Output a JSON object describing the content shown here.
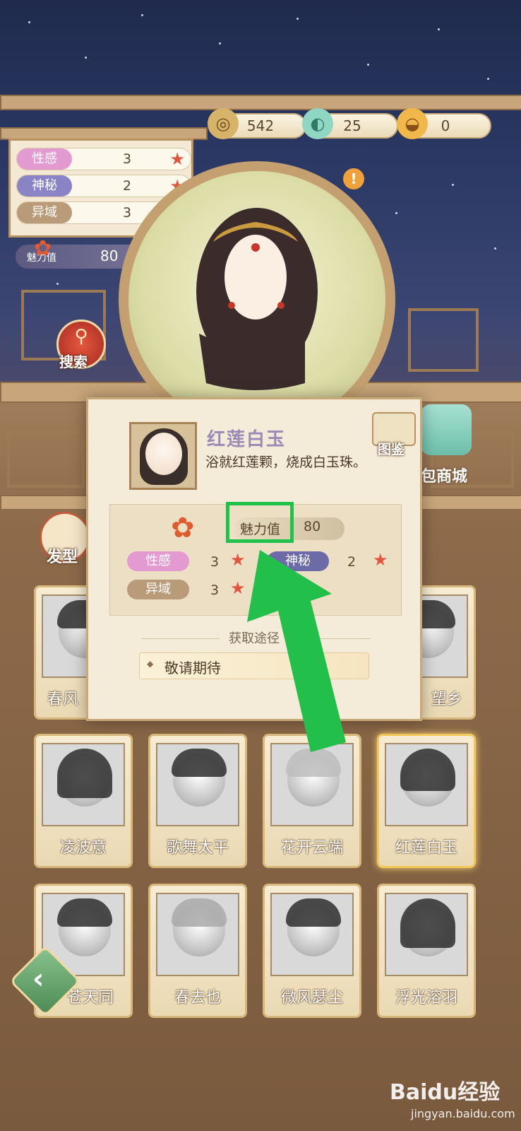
{
  "currency": [
    {
      "icon": "coin-icon",
      "value": "542"
    },
    {
      "icon": "jade-icon",
      "value": "25"
    },
    {
      "icon": "gold-ingot-icon",
      "value": "0"
    }
  ],
  "attributes": [
    {
      "label": "性感",
      "value": "3",
      "color": "#e39ad0"
    },
    {
      "label": "神秘",
      "value": "2",
      "color": "#8a84c6"
    },
    {
      "label": "异域",
      "value": "3",
      "color": "#b99b79"
    }
  ],
  "charm": {
    "label": "魅力值",
    "value": "80"
  },
  "search_label": "搜索",
  "shop_label": "包商城",
  "tab_label": "发型",
  "popup": {
    "name": "红莲白玉",
    "desc": "浴就红莲颗，烧成白玉珠。",
    "atlas_label": "图鉴",
    "charm_label": "魅力值",
    "charm_value": "80",
    "stats": [
      {
        "label": "性感",
        "value": "3",
        "color": "#e39ad0"
      },
      {
        "label": "神秘",
        "value": "2",
        "color": "#6d6aa8"
      },
      {
        "label": "异域",
        "value": "3",
        "color": "#b99b79"
      }
    ],
    "acq_title": "获取途径",
    "acq_value": "敬请期待"
  },
  "grid": {
    "row1_visible": [
      "春风",
      "望乡"
    ],
    "row2": [
      "凌波意",
      "歌舞太平",
      "花开云端",
      "红莲白玉"
    ],
    "row3": [
      "苍天同",
      "春去也",
      "微风瑟尘",
      "浮光溶羽"
    ]
  },
  "watermark": {
    "logo": "Baidu经验",
    "url": "jingyan.baidu.com"
  }
}
